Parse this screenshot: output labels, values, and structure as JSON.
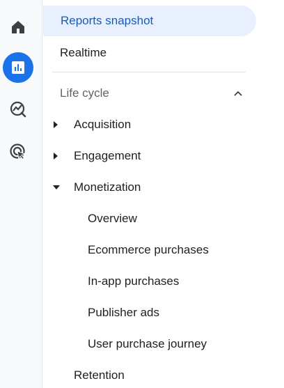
{
  "rail": {
    "items": [
      {
        "icon": "home-icon"
      },
      {
        "icon": "reports-icon",
        "active": true
      },
      {
        "icon": "explore-icon"
      },
      {
        "icon": "advertising-icon"
      }
    ]
  },
  "nav": {
    "reports_snapshot": "Reports snapshot",
    "realtime": "Realtime",
    "life_cycle": {
      "label": "Life cycle",
      "expanded": true,
      "groups": [
        {
          "label": "Acquisition",
          "expanded": false
        },
        {
          "label": "Engagement",
          "expanded": false
        },
        {
          "label": "Monetization",
          "expanded": true,
          "children": [
            "Overview",
            "Ecommerce purchases",
            "In-app purchases",
            "Publisher ads",
            "User purchase journey"
          ]
        },
        {
          "label": "Retention"
        }
      ]
    }
  },
  "colors": {
    "accent": "#1a73e8",
    "selected_bg": "#e8f0fe",
    "selected_text": "#1a5bb8"
  }
}
